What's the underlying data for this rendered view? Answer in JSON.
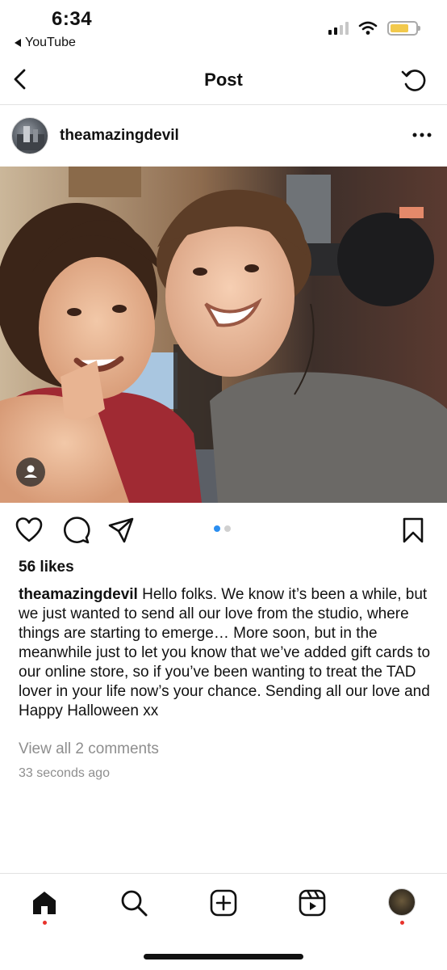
{
  "status_bar": {
    "time": "6:34",
    "back_app": "YouTube",
    "battery_color": "#f2c94c"
  },
  "nav": {
    "title": "Post",
    "back_icon": "chevron-left-icon",
    "refresh_icon": "refresh-icon"
  },
  "post": {
    "username": "theamazingdevil",
    "more_icon": "more-horizontal-icon",
    "image_description_icon": "tagged-user-icon",
    "carousel": {
      "count": 2,
      "active": 0,
      "active_color": "#2b8ef0"
    },
    "likes": "56 likes",
    "caption_user": "theamazingdevil",
    "caption_text": "Hello folks. We know it’s been a while, but we just wanted to send all our love from the studio, where things are starting to emerge… More soon, but in the meanwhile just to let you know that we’ve added gift cards to our online store, so if you’ve been wanting to treat the TAD lover in your life now’s your chance. Sending all our love and Happy Halloween xx",
    "comments_link": "View all 2 comments",
    "timestamp": "33 seconds ago",
    "actions": [
      "heart-icon",
      "comment-icon",
      "share-icon",
      "bookmark-icon"
    ]
  },
  "tab_bar": {
    "items": [
      "home-icon",
      "search-icon",
      "create-icon",
      "reels-icon",
      "profile-avatar"
    ],
    "notification_dot_color": "#e8322b"
  }
}
